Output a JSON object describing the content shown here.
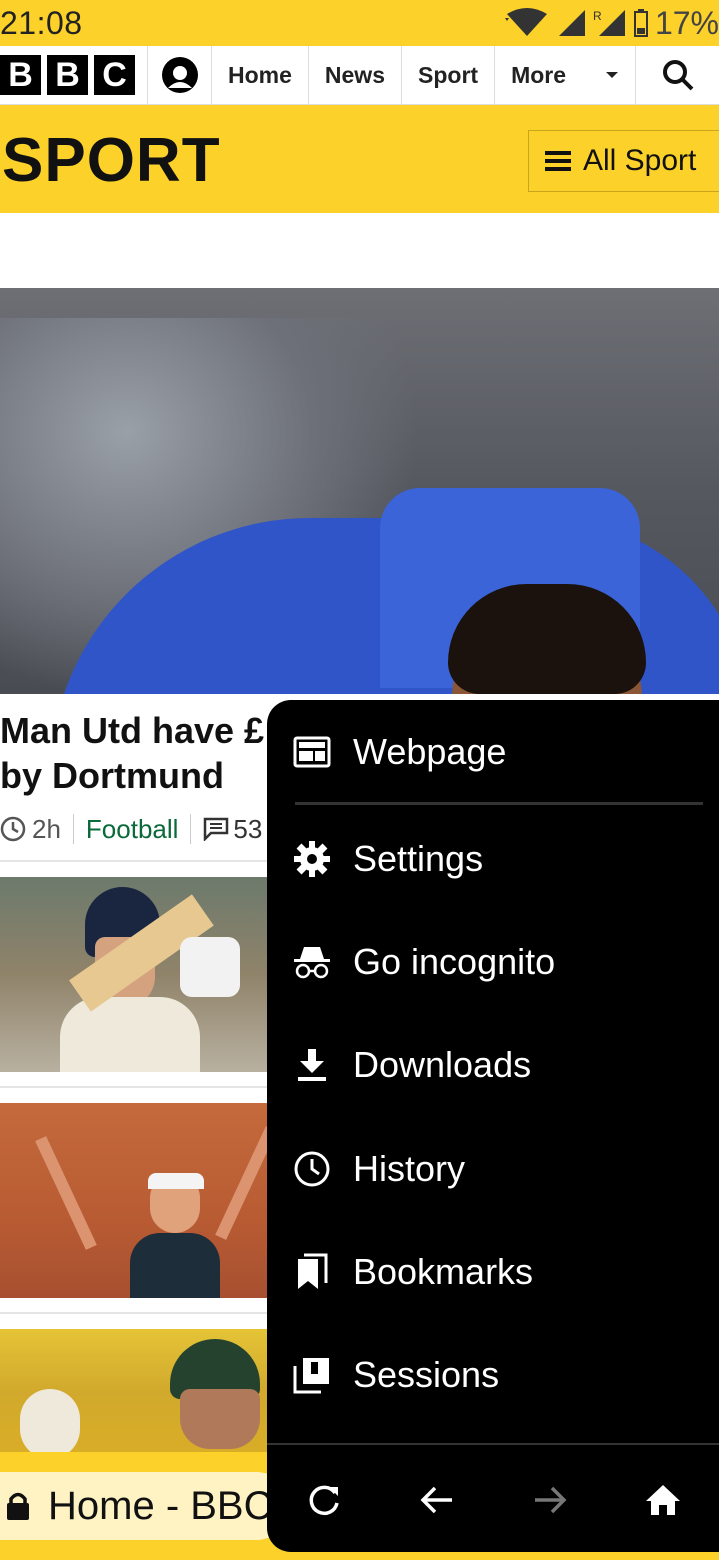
{
  "status_bar": {
    "time": "21:08",
    "battery": "17%"
  },
  "bbc_nav": {
    "logo_letters": [
      "B",
      "B",
      "C"
    ],
    "links": [
      "Home",
      "News",
      "Sport"
    ],
    "more_label": "More"
  },
  "sport_header": {
    "title": "SPORT",
    "all_sport_label": "All Sport"
  },
  "article": {
    "headline_line1": "Man Utd have £",
    "headline_line2": "by Dortmund",
    "time_ago": "2h",
    "category": "Football",
    "comments": "53"
  },
  "url_bar": {
    "text": "Home - BBC"
  },
  "menu": {
    "items": [
      {
        "label": "Webpage",
        "icon": "webpage-icon"
      },
      {
        "label": "Settings",
        "icon": "gear-icon"
      },
      {
        "label": "Go incognito",
        "icon": "incognito-icon"
      },
      {
        "label": "Downloads",
        "icon": "download-icon"
      },
      {
        "label": "History",
        "icon": "clock-icon"
      },
      {
        "label": "Bookmarks",
        "icon": "bookmark-icon"
      },
      {
        "label": "Sessions",
        "icon": "sessions-icon"
      }
    ],
    "bottom_icons": [
      "reload-icon",
      "back-arrow-icon",
      "forward-arrow-icon",
      "home-icon"
    ]
  },
  "colors": {
    "bbc_sport_yellow": "#fcd12a",
    "menu_background": "#000000",
    "category_green": "#0b6a3a"
  }
}
